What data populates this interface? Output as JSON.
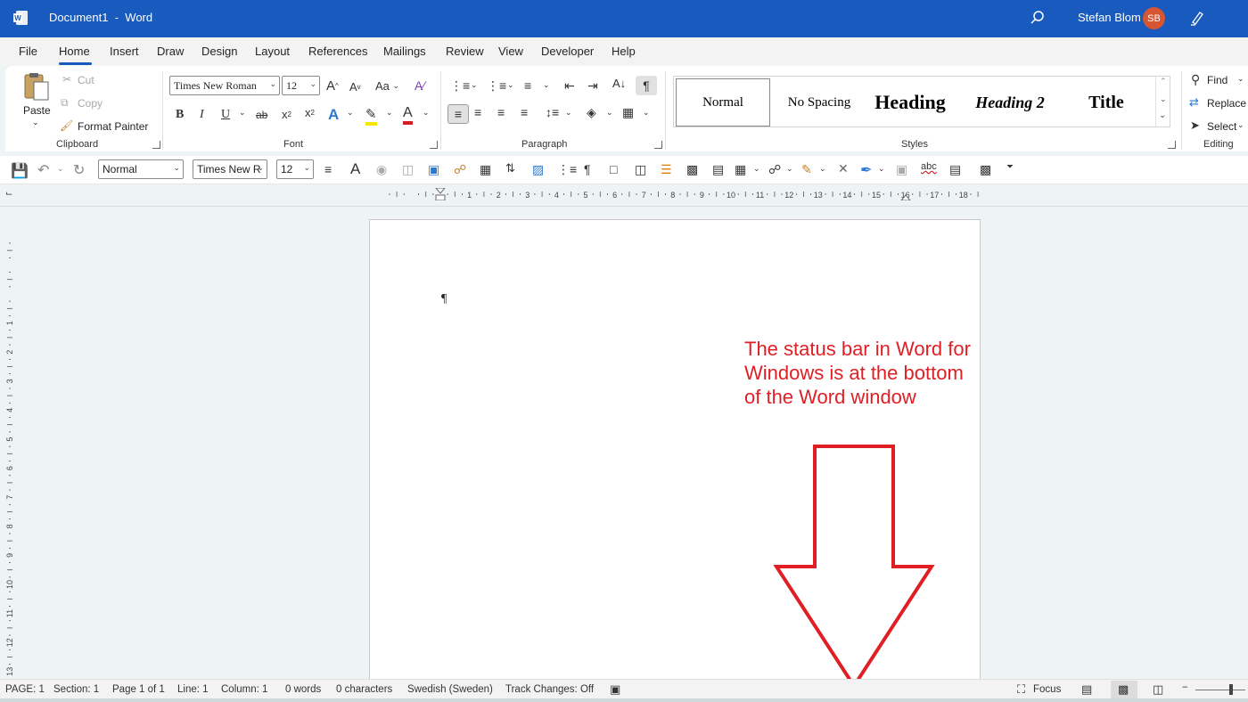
{
  "titlebar": {
    "document_name": "Document1",
    "separator": "-",
    "app_name": "Word",
    "user_name": "Stefan Blom",
    "user_initials": "SB"
  },
  "tabs": [
    "File",
    "Home",
    "Insert",
    "Draw",
    "Design",
    "Layout",
    "References",
    "Mailings",
    "Review",
    "View",
    "Developer",
    "Help"
  ],
  "active_tab": "Home",
  "ribbon": {
    "clipboard": {
      "label": "Clipboard",
      "paste": "Paste",
      "cut": "Cut",
      "copy": "Copy",
      "format_painter": "Format Painter"
    },
    "font": {
      "label": "Font",
      "font_name": "Times New Roman",
      "font_size": "12",
      "bold": "B",
      "italic": "I",
      "underline": "U",
      "strikethrough": "ab",
      "change_case": "Aa"
    },
    "paragraph": {
      "label": "Paragraph"
    },
    "styles": {
      "label": "Styles",
      "items": [
        "Normal",
        "No Spacing",
        "Heading",
        "Heading 2",
        "Title"
      ]
    },
    "editing": {
      "label": "Editing",
      "find": "Find",
      "replace": "Replace",
      "select": "Select"
    }
  },
  "qat": {
    "style": "Normal",
    "font": "Times New R",
    "size": "12"
  },
  "document": {
    "annotation": "The status bar in Word for Windows is at the bottom of the Word window"
  },
  "statusbar": {
    "page": "PAGE: 1",
    "section": "Section: 1",
    "page_of": "Page 1 of 1",
    "line": "Line: 1",
    "column": "Column: 1",
    "words": "0 words",
    "characters": "0 characters",
    "language": "Swedish (Sweden)",
    "track_changes": "Track Changes: Off",
    "focus": "Focus"
  },
  "colors": {
    "titlebar": "#185abd",
    "annotation": "#e01f25",
    "avatar": "#d65532"
  }
}
